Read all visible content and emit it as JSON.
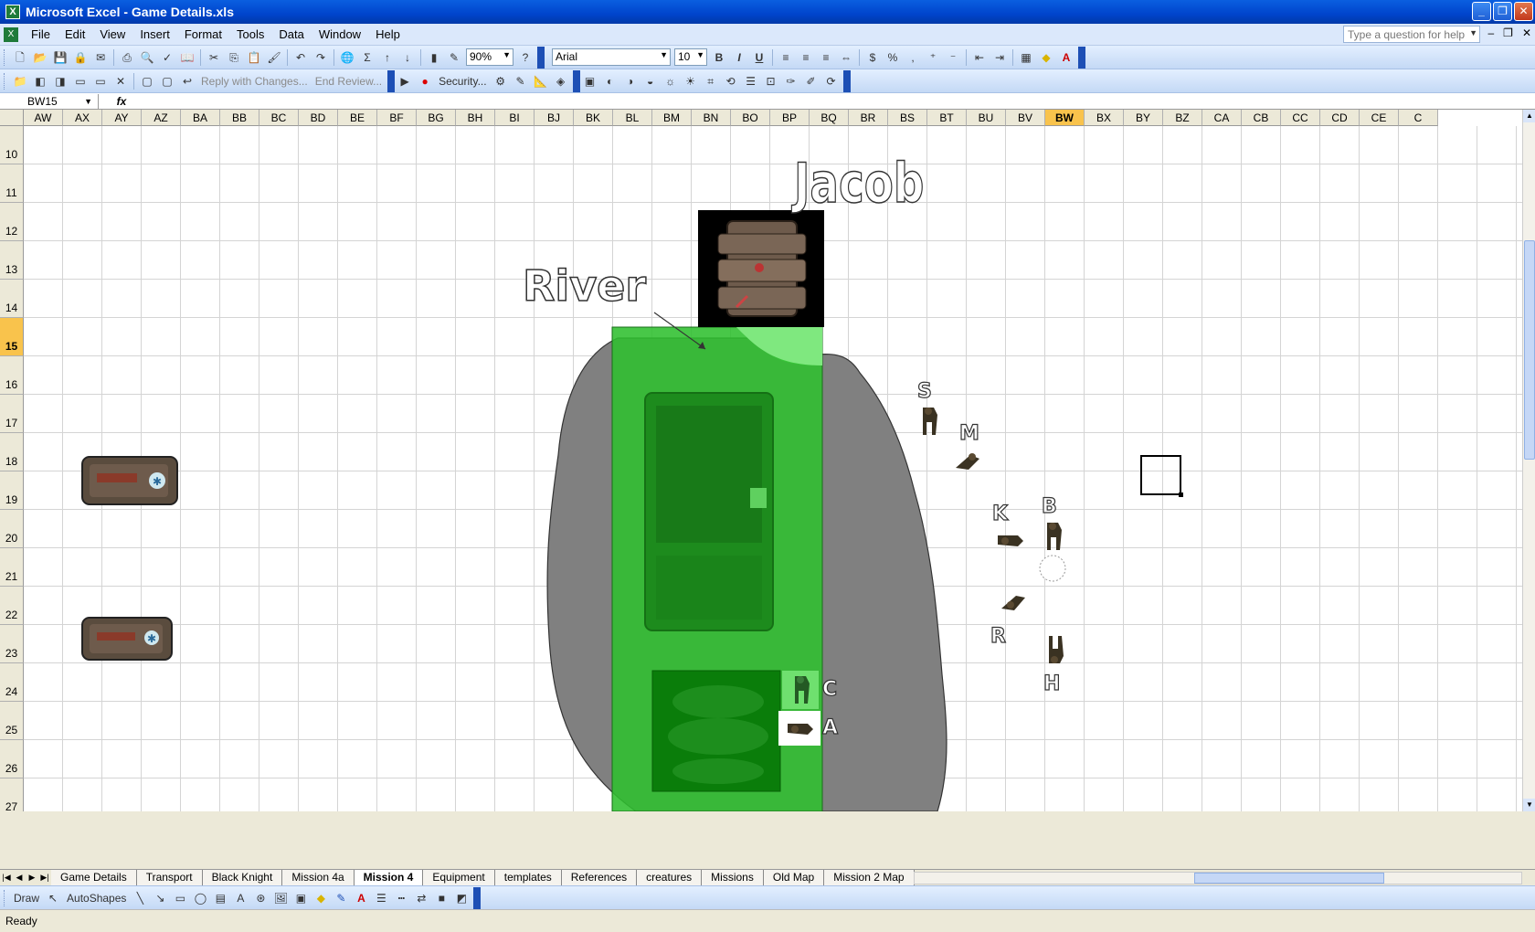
{
  "window": {
    "title": "Microsoft Excel - Game Details.xls",
    "app_icon": "excel-icon"
  },
  "menu": {
    "items": [
      "File",
      "Edit",
      "View",
      "Insert",
      "Format",
      "Tools",
      "Data",
      "Window",
      "Help"
    ],
    "help_placeholder": "Type a question for help"
  },
  "toolbar": {
    "zoom": "90%",
    "font_name": "Arial",
    "font_size": "10",
    "bold": "B",
    "italic": "I",
    "underline": "U",
    "percent": "%",
    "comma": ","
  },
  "review_toolbar": {
    "reply_with_changes": "Reply with Changes...",
    "end_review": "End Review...",
    "security": "Security..."
  },
  "formula_bar": {
    "name_box": "BW15",
    "fx": "fx",
    "content": ""
  },
  "grid": {
    "columns": [
      "AW",
      "AX",
      "AY",
      "AZ",
      "BA",
      "BB",
      "BC",
      "BD",
      "BE",
      "BF",
      "BG",
      "BH",
      "BI",
      "BJ",
      "BK",
      "BL",
      "BM",
      "BN",
      "BO",
      "BP",
      "BQ",
      "BR",
      "BS",
      "BT",
      "BU",
      "BV",
      "BW",
      "BX",
      "BY",
      "BZ",
      "CA",
      "CB",
      "CC",
      "CD",
      "CE",
      "C"
    ],
    "rows": [
      "10",
      "11",
      "12",
      "13",
      "14",
      "15",
      "16",
      "17",
      "18",
      "19",
      "20",
      "21",
      "22",
      "23",
      "24",
      "25",
      "26",
      "27"
    ],
    "selected_column": "BW",
    "selected_row": "15"
  },
  "map": {
    "jacob_label": "Jacob",
    "river_label": "River",
    "letters": {
      "s": "S",
      "m": "M",
      "k": "K",
      "b": "B",
      "r": "R",
      "h": "H",
      "c": "C",
      "a": "A"
    },
    "colors": {
      "river_green": "#2fbf2f",
      "river_light": "#7fe87f",
      "rock_grey": "#808080",
      "dark_green": "#0a7d0a"
    }
  },
  "sheet_tabs": {
    "tabs": [
      "Game Details",
      "Transport",
      "Black Knight",
      "Mission 4a",
      "Mission 4",
      "Equipment",
      "templates",
      "References",
      "creatures",
      "Missions",
      "Old Map",
      "Mission 2 Map"
    ],
    "active": "Mission 4"
  },
  "draw_toolbar": {
    "draw": "Draw",
    "autoshapes": "AutoShapes"
  },
  "status": {
    "text": "Ready"
  }
}
